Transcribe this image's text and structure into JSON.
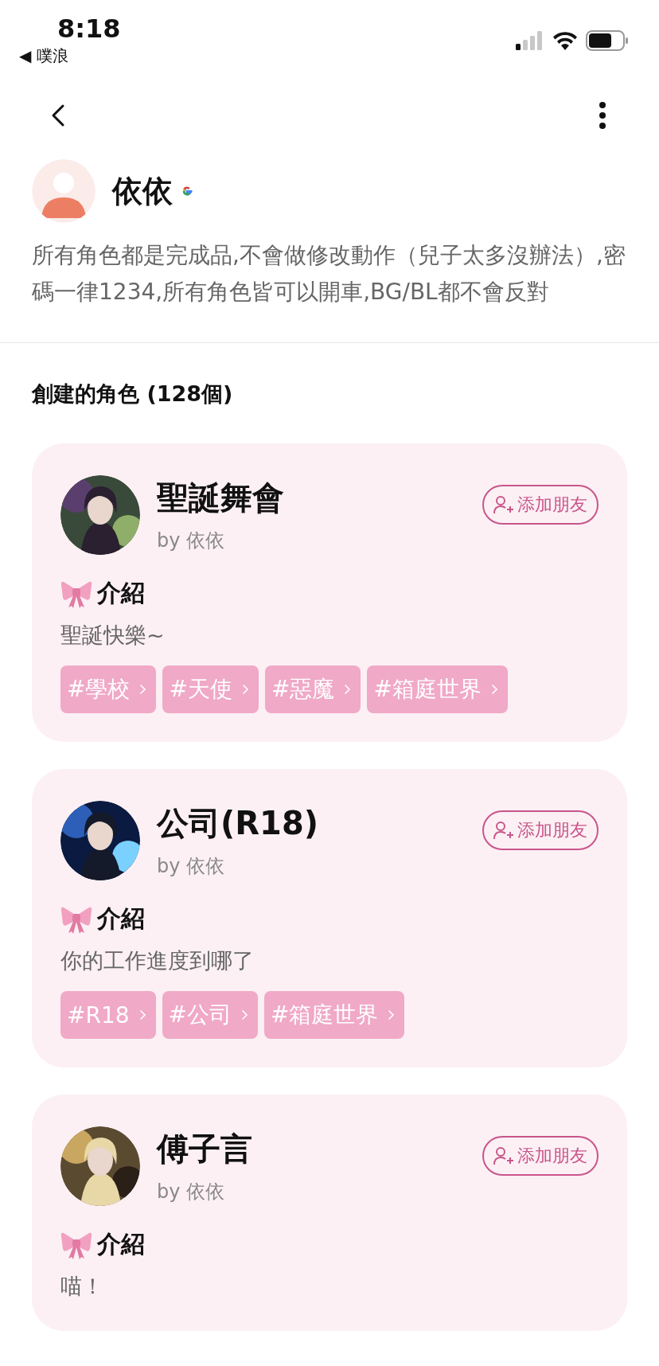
{
  "status_bar": {
    "time": "8:18",
    "back_app": "◀ 噗浪"
  },
  "profile": {
    "name": "依依",
    "bio": "所有角色都是完成品,不會做修改動作（兒子太多沒辦法）,密碼一律1234,所有角色皆可以開車,BG/BL都不會反對"
  },
  "section_title": "創建的角色 (128個)",
  "characters": [
    {
      "name": "聖誕舞會",
      "author": "by 依依",
      "add_label": "添加朋友",
      "intro_label": "介紹",
      "intro": "聖誕快樂~",
      "tags": [
        "#學校",
        "#天使",
        "#惡魔",
        "#箱庭世界"
      ]
    },
    {
      "name": "公司(R18)",
      "author": "by 依依",
      "add_label": "添加朋友",
      "intro_label": "介紹",
      "intro": "你的工作進度到哪了",
      "tags": [
        "#R18",
        "#公司",
        "#箱庭世界"
      ]
    },
    {
      "name": "傅子言",
      "author": "by 依依",
      "add_label": "添加朋友",
      "intro_label": "介紹",
      "intro": "喵！"
    }
  ]
}
